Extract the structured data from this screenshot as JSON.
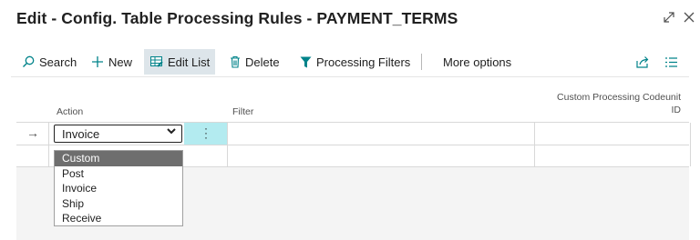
{
  "window": {
    "title": "Edit - Config. Table Processing Rules - PAYMENT_TERMS",
    "expand_icon": "expand-icon",
    "close_icon": "close-icon"
  },
  "toolbar": {
    "search": "Search",
    "new": "New",
    "edit_list": "Edit List",
    "delete": "Delete",
    "processing_filters": "Processing Filters",
    "more_options": "More options"
  },
  "columns": {
    "action": "Action",
    "filter": "Filter",
    "codeunit_line1": "Custom Processing Codeunit",
    "codeunit_line2": "ID"
  },
  "row": {
    "action_value": "Invoice"
  },
  "dropdown": {
    "options": [
      "Custom",
      "Post",
      "Invoice",
      "Ship",
      "Receive"
    ],
    "selected": "Custom"
  },
  "colors": {
    "accent": "#00838a",
    "selected_cell": "#b3ebf0",
    "option_highlight": "#6e6e6e"
  }
}
